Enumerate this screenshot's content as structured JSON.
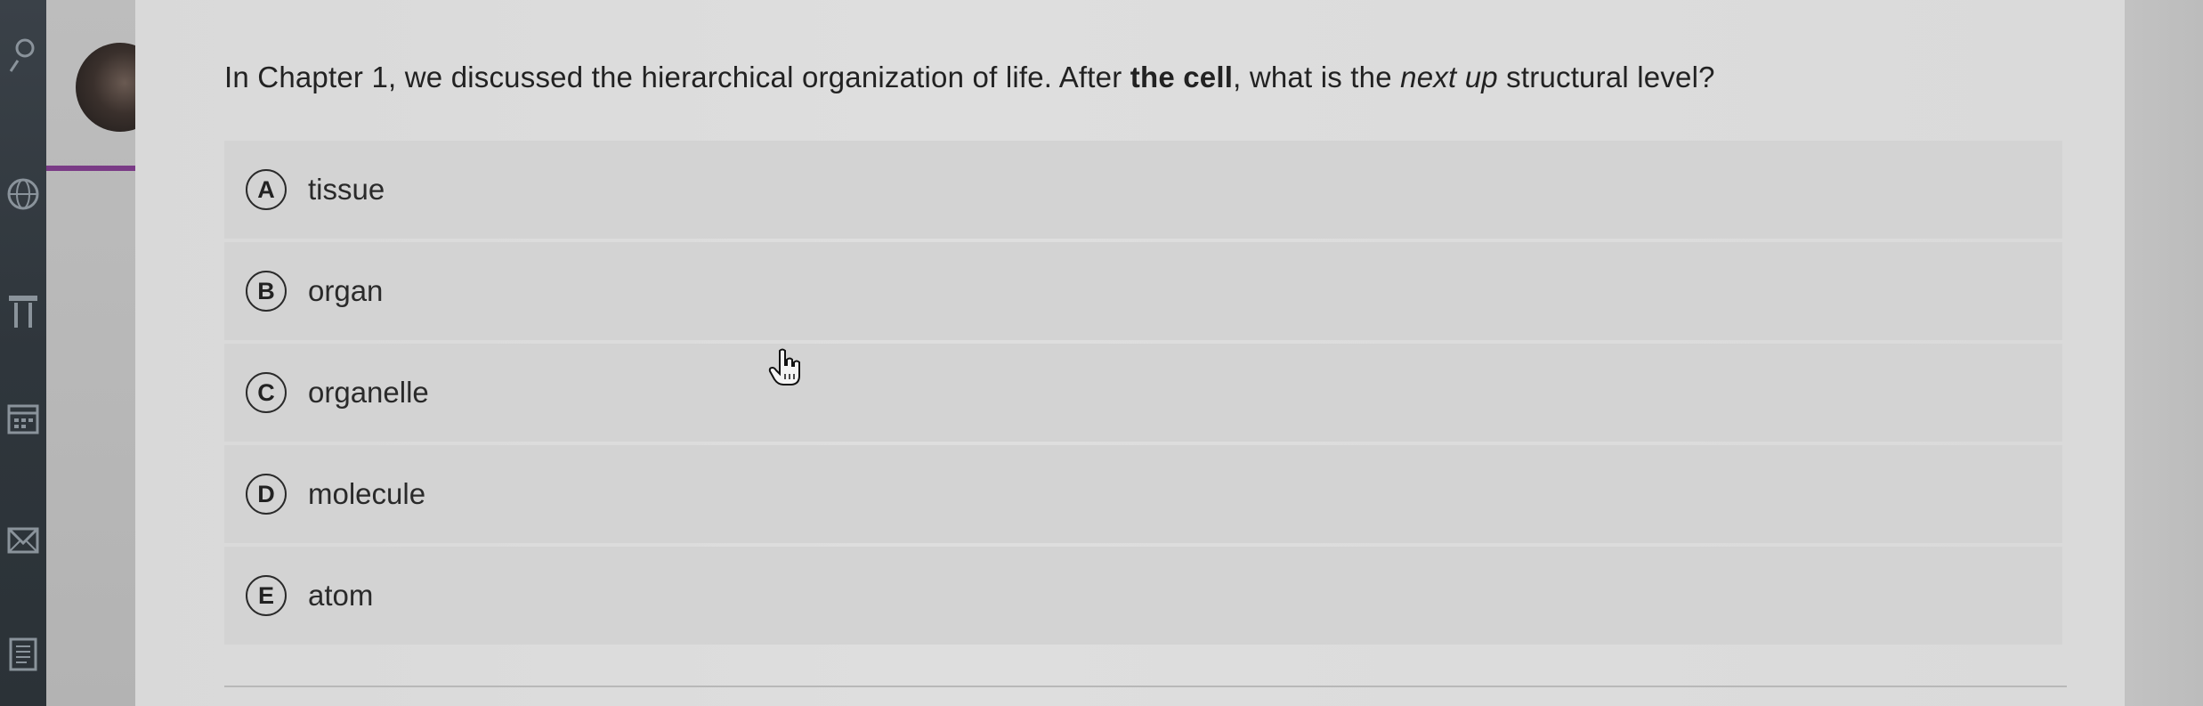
{
  "nav": {
    "icons": [
      "user-icon",
      "globe-icon",
      "institution-icon",
      "calendar-icon",
      "messages-icon",
      "grades-icon"
    ]
  },
  "question": {
    "prefix": "In Chapter 1, we discussed the hierarchical organization of life. After ",
    "bold": "the cell",
    "middle": ", what is the ",
    "italic": "next up",
    "suffix": " structural level?"
  },
  "options": [
    {
      "letter": "A",
      "label": "tissue"
    },
    {
      "letter": "B",
      "label": "organ"
    },
    {
      "letter": "C",
      "label": "organelle"
    },
    {
      "letter": "D",
      "label": "molecule"
    },
    {
      "letter": "E",
      "label": "atom"
    }
  ],
  "colors": {
    "nav_bg": "#2f363c",
    "accent": "#7a3b86",
    "panel_bg": "#dedede",
    "option_bg": "#d3d3d3"
  }
}
